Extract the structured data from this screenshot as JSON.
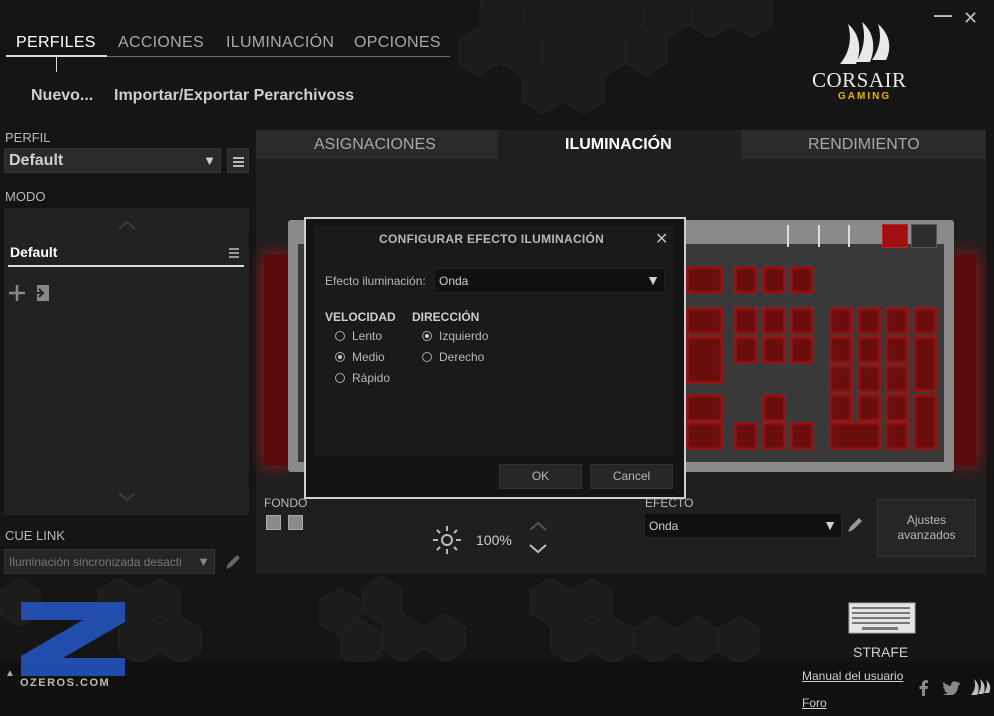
{
  "nav": {
    "tabs": [
      {
        "label": "PERFILES",
        "active": true
      },
      {
        "label": "ACCIONES",
        "active": false
      },
      {
        "label": "ILUMINACIÓN",
        "active": false
      },
      {
        "label": "OPCIONES",
        "active": false
      }
    ],
    "sub_links": [
      "Nuevo...",
      "Importar/Exportar Perarchivoss"
    ],
    "window_controls": {
      "minimize": "—",
      "close": "✕"
    }
  },
  "logo": {
    "brand": "CORSAIR",
    "tagline": "GAMING"
  },
  "left": {
    "profile_label": "PERFIL",
    "profile_value": "Default",
    "mode_label": "MODO",
    "mode_item": "Default",
    "cue_link_label": "CUE LINK",
    "cue_link_value": "Iluminación sincronizada desacti"
  },
  "main": {
    "tabs": [
      {
        "label": "ASIGNACIONES",
        "active": false
      },
      {
        "label": "ILUMINACIÓN",
        "active": true
      },
      {
        "label": "RENDIMIENTO",
        "active": false
      }
    ],
    "fondo_label": "FONDO",
    "brightness": "100%",
    "efecto_label": "EFECTO",
    "efecto_value": "Onda",
    "advanced_btn_line1": "Ajustes",
    "advanced_btn_line2": "avanzados"
  },
  "dialog": {
    "title": "CONFIGURAR EFECTO ILUMINACIÓN",
    "effect_label": "Efecto iluminación:",
    "effect_value": "Onda",
    "speed_heading": "VELOCIDAD",
    "speed_options": [
      {
        "label": "Lento",
        "selected": false
      },
      {
        "label": "Medio",
        "selected": true
      },
      {
        "label": "Rápido",
        "selected": false
      }
    ],
    "direction_heading": "DIRECCIÓN",
    "direction_options": [
      {
        "label": "Izquierdo",
        "selected": true
      },
      {
        "label": "Derecho",
        "selected": false
      }
    ],
    "ok_label": "OK",
    "cancel_label": "Cancel"
  },
  "footer": {
    "device_name": "STRAFE",
    "manual_link": "Manual del usuario",
    "forum_link": "Foro",
    "watermark": "OZEROS.COM"
  },
  "colors": {
    "accent_red": "#b41414",
    "logo_gold": "#e8b400",
    "watermark_blue": "#2457c8"
  }
}
